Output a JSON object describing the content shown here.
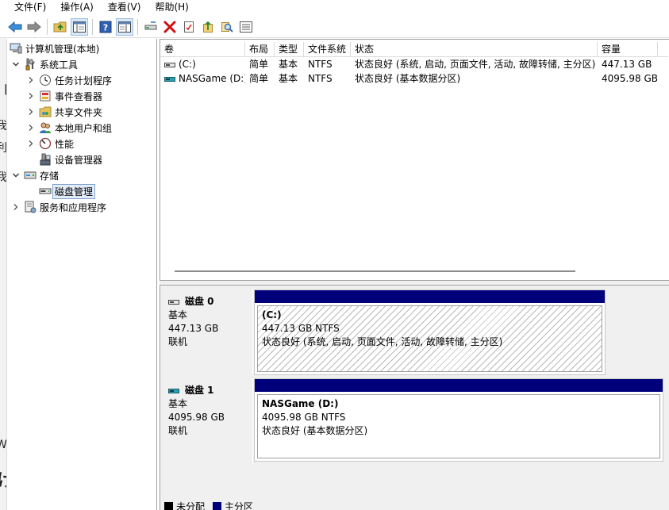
{
  "menu": [
    "文件(F)",
    "操作(A)",
    "查看(V)",
    "帮助(H)"
  ],
  "toolbar_icons": [
    "back-arrow-icon",
    "forward-arrow-icon",
    "folder-up-icon",
    "console-tree-icon",
    "help-icon",
    "show-action-pane-icon",
    "connect-drive-icon",
    "delete-icon",
    "properties-icon",
    "export-icon",
    "search-icon",
    "list-icon"
  ],
  "edge_glyphs": [
    "刂",
    "我",
    "利",
    "我",
    "W",
    "け"
  ],
  "tree": {
    "root": "计算机管理(本地)",
    "system_tools": "系统工具",
    "task_scheduler": "任务计划程序",
    "event_viewer": "事件查看器",
    "shared_folders": "共享文件夹",
    "local_users": "本地用户和组",
    "performance": "性能",
    "device_manager": "设备管理器",
    "storage": "存储",
    "disk_management": "磁盘管理",
    "services": "服务和应用程序"
  },
  "volume_table": {
    "columns": [
      "卷",
      "布局",
      "类型",
      "文件系统",
      "状态",
      "容量"
    ],
    "rows": [
      [
        "(C:)",
        "简单",
        "基本",
        "NTFS",
        "状态良好 (系统, 启动, 页面文件, 活动, 故障转储, 主分区)",
        "447.13 GB"
      ],
      [
        "NASGame (D:)",
        "简单",
        "基本",
        "NTFS",
        "状态良好 (基本数据分区)",
        "4095.98 GB"
      ]
    ]
  },
  "disks": [
    {
      "name": "磁盘 0",
      "type": "基本",
      "size": "447.13 GB",
      "status": "联机",
      "partition": {
        "name": "(C:)",
        "size_fs": "447.13 GB NTFS",
        "status": "状态良好 (系统, 启动, 页面文件, 活动, 故障转储, 主分区)"
      }
    },
    {
      "name": "磁盘 1",
      "type": "基本",
      "size": "4095.98 GB",
      "status": "联机",
      "partition": {
        "name": "NASGame   (D:)",
        "size_fs": "4095.98 GB NTFS",
        "status": "状态良好 (基本数据分区)"
      }
    }
  ],
  "legend": {
    "unallocated": "未分配",
    "primary": "主分区",
    "unallocated_color": "#000000",
    "primary_color": "#00007b"
  }
}
